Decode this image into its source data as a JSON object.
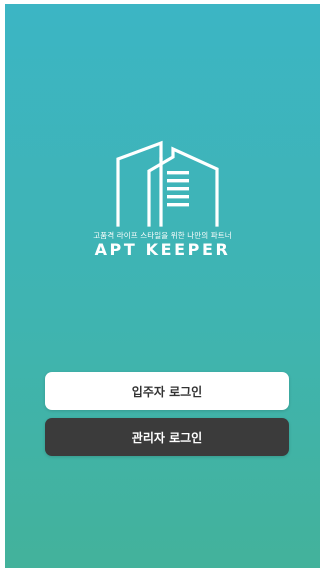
{
  "app": {
    "tagline": "고품격 라이프 스타일을 위한 나만의 파트너",
    "brand_name": "APT KEEPER",
    "logo_icon": "apartment-building-icon"
  },
  "buttons": {
    "resident_login_label": "입주자 로그인",
    "admin_login_label": "관리자 로그인"
  },
  "colors": {
    "gradient_top": "#3cb5c4",
    "gradient_bottom": "#43b29b",
    "resident_button_bg": "#ffffff",
    "admin_button_bg": "#3b3b3b"
  }
}
